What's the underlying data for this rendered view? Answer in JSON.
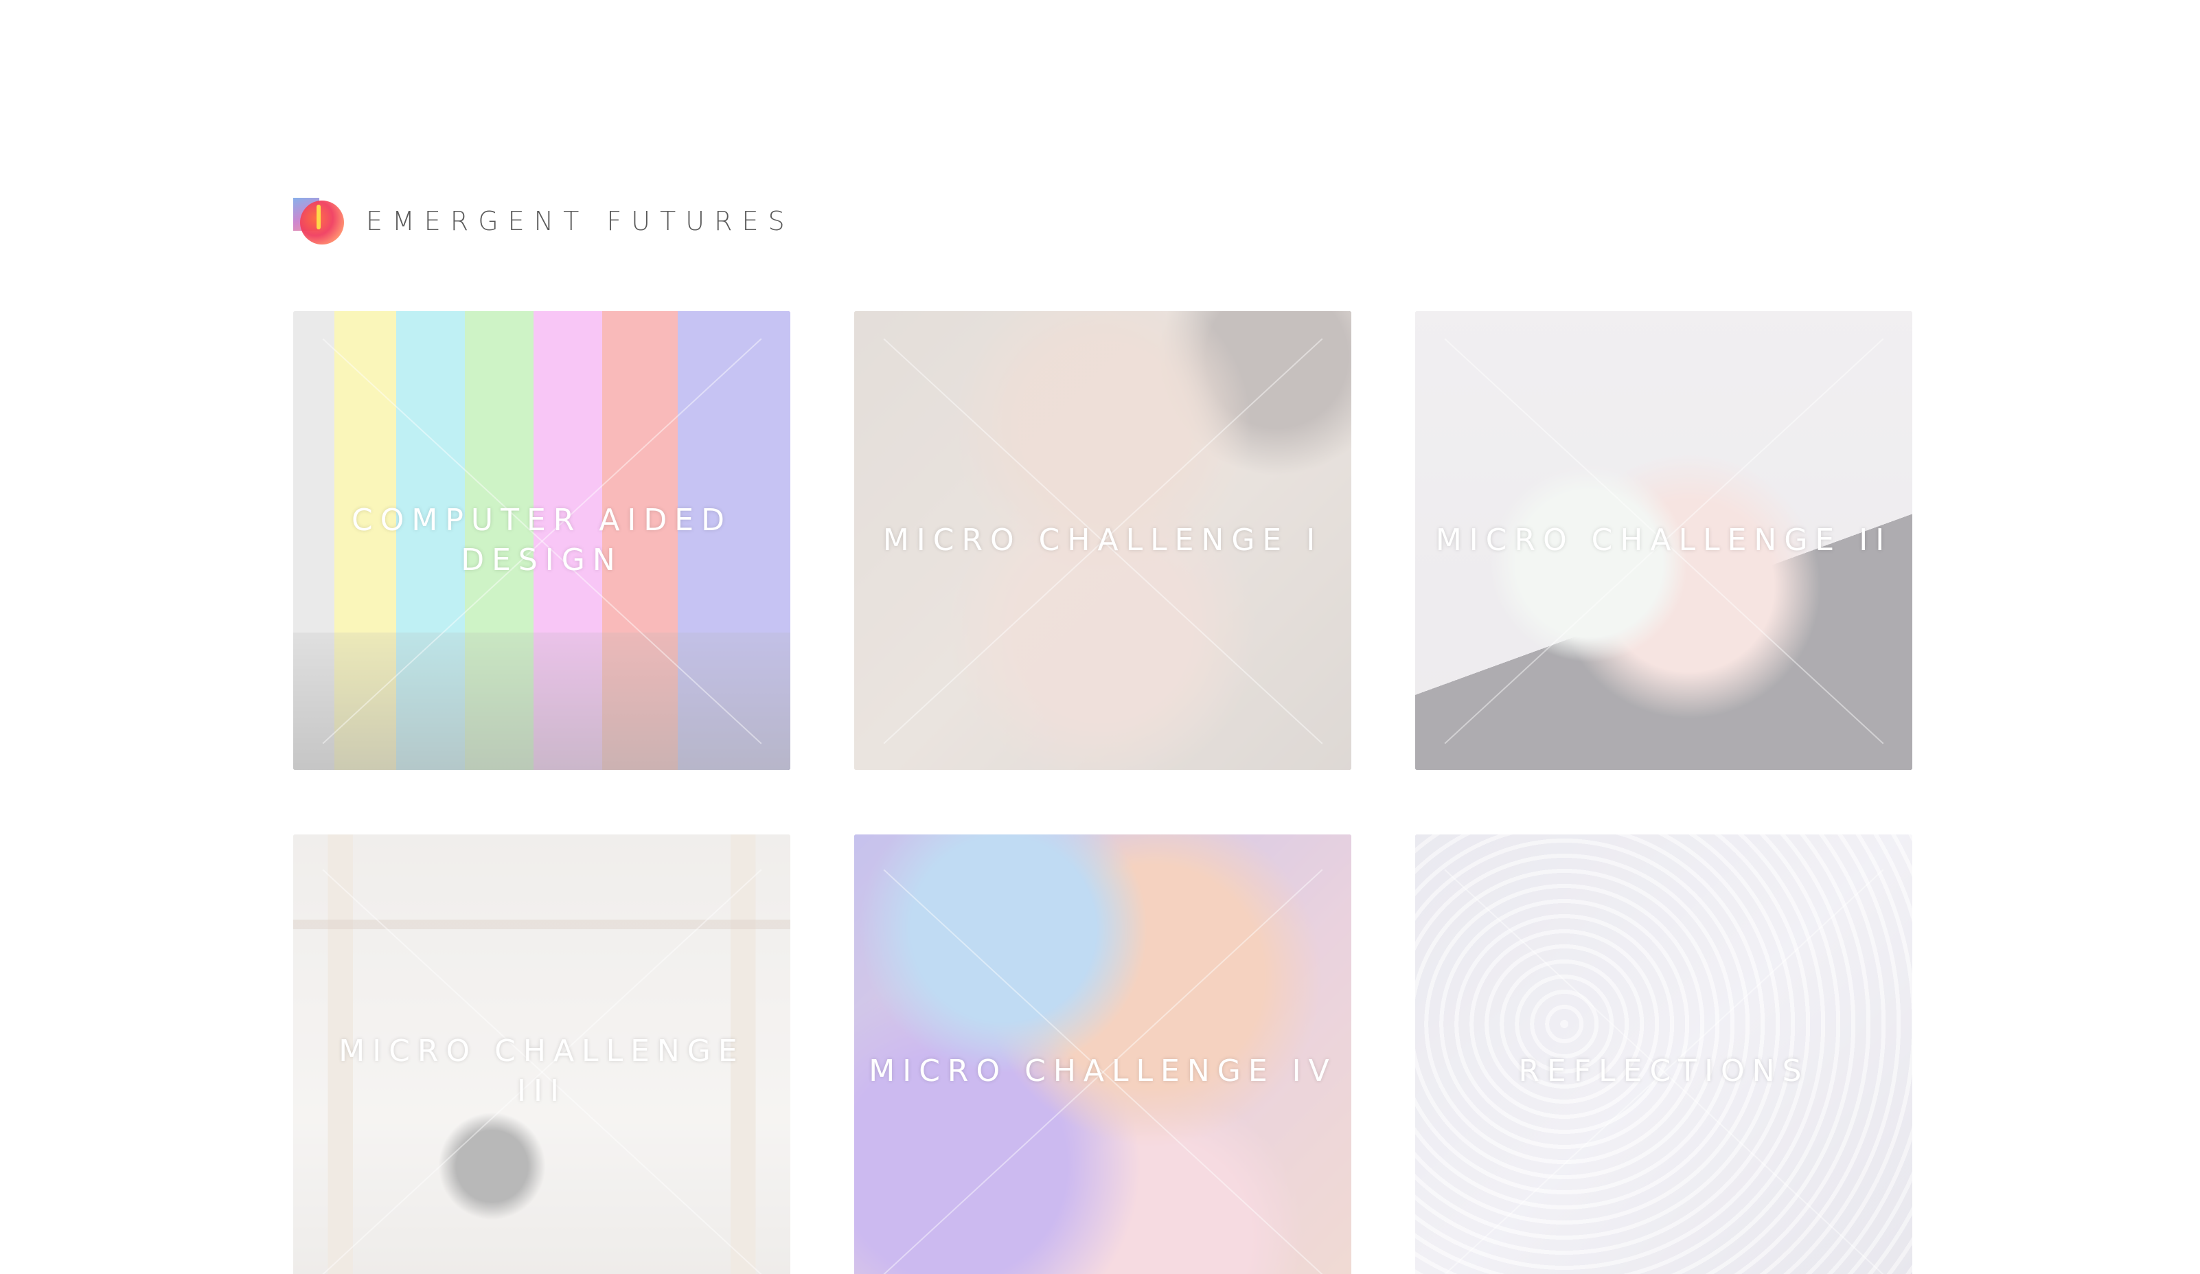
{
  "header": {
    "site_title": "EMERGENT FUTURES"
  },
  "cards": [
    {
      "label": "COMPUTER AIDED DESIGN"
    },
    {
      "label": "MICRO CHALLENGE I"
    },
    {
      "label": "MICRO CHALLENGE II"
    },
    {
      "label": "MICRO CHALLENGE III"
    },
    {
      "label": "MICRO CHALLENGE IV"
    },
    {
      "label": "REFLECTIONS"
    }
  ],
  "colors": {
    "background": "#ffffff",
    "title_text": "#5a5a5a",
    "card_label": "#ffffff"
  }
}
